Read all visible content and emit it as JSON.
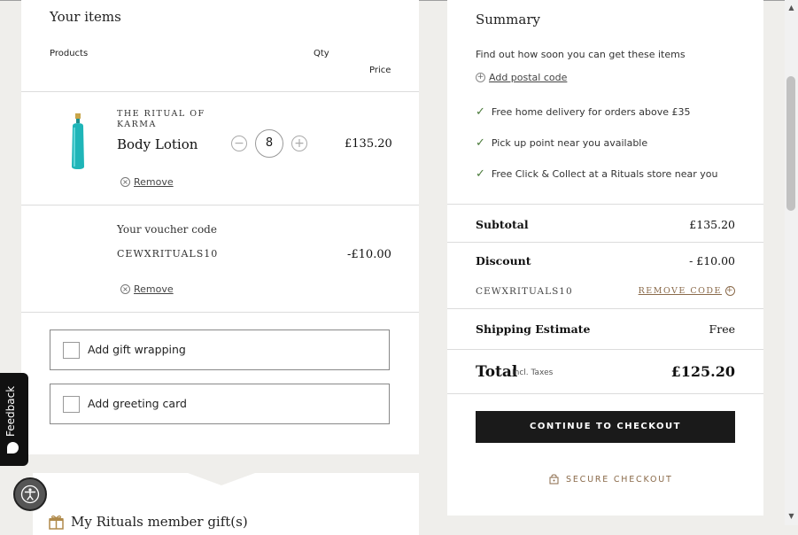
{
  "cart": {
    "title": "Your items",
    "col_products": "Products",
    "col_qty": "Qty",
    "col_price": "Price",
    "item": {
      "brand": "THE RITUAL OF KARMA",
      "name": "Body Lotion",
      "qty": "8",
      "price": "£135.20",
      "remove": "Remove"
    },
    "voucher": {
      "label": "Your voucher code",
      "code": "CEWXRITUALS10",
      "amount": "-£10.00",
      "remove": "Remove"
    },
    "gift_wrapping": "Add gift wrapping",
    "greeting_card": "Add greeting card",
    "member_gifts": "My Rituals member gift(s)"
  },
  "summary": {
    "title": "Summary",
    "find_out": "Find out how soon you can get these items",
    "add_postal": "Add postal code",
    "benefits": [
      "Free home delivery for orders above £35",
      "Pick up point near you available",
      "Free Click & Collect at a Rituals store near you"
    ],
    "subtotal_label": "Subtotal",
    "subtotal_value": "£135.20",
    "discount_label": "Discount",
    "discount_value": "- £10.00",
    "code": "CEWXRITUALS10",
    "remove_code": "REMOVE CODE",
    "shipping_label": "Shipping Estimate",
    "shipping_value": "Free",
    "total_label": "Total",
    "total_tax": "Incl. Taxes",
    "total_value": "£125.20",
    "checkout_button": "CONTINUE TO CHECKOUT",
    "secure": "SECURE CHECKOUT"
  },
  "feedback": {
    "label": "Feedback"
  },
  "icons": {
    "check": "check-icon",
    "remove": "close-circle-icon",
    "add": "plus-circle-icon",
    "lock": "lock-icon",
    "gift": "gift-icon",
    "accessibility": "accessibility-icon"
  },
  "colors": {
    "accent": "#8a6a4a",
    "check": "#4a7a3a",
    "button_bg": "#1a1a1a",
    "page_bg": "#efeeeb"
  }
}
